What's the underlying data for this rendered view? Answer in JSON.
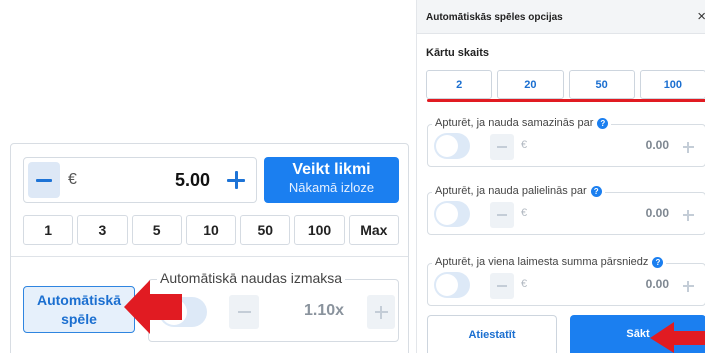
{
  "bet_panel": {
    "currency": "€",
    "stake_value": "5.00",
    "place_bet": {
      "title": "Veikt likmi",
      "subtitle": "Nākamā izloze"
    },
    "quick_amounts": [
      "1",
      "3",
      "5",
      "10",
      "50",
      "100",
      "Max"
    ],
    "autoplay_button": {
      "line1": "Automātiskā",
      "line2": "spēle"
    },
    "auto_cashout": {
      "label": "Automātiskā naudas izmaksa",
      "value": "1.10x"
    }
  },
  "dialog": {
    "title": "Automātiskās spēles opcijas",
    "close_symbol": "×",
    "rounds_label": "Kārtu skaits",
    "rounds": [
      "2",
      "20",
      "50",
      "100"
    ],
    "conditions": [
      {
        "label": "Apturēt, ja nauda samazinās par",
        "currency": "€",
        "value": "0.00"
      },
      {
        "label": "Apturēt, ja nauda palielinās par",
        "currency": "€",
        "value": "0.00"
      },
      {
        "label": "Apturēt, ja viena laimesta summa pārsniedz",
        "currency": "€",
        "value": "0.00"
      }
    ],
    "help_symbol": "?",
    "reset_label": "Atiestatīt",
    "start_label": "Sākt"
  },
  "colors": {
    "primary": "#1b7ff0",
    "primary_text": "#1b6fd0",
    "annotation_red": "#e11b22",
    "toggle_off": "#dde9f7"
  }
}
